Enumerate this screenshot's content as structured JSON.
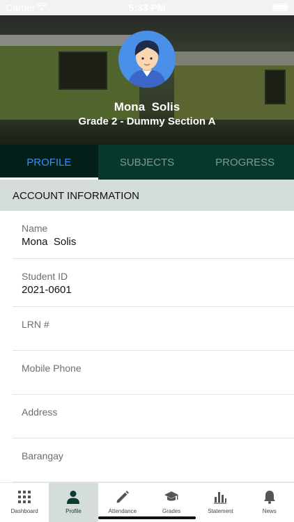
{
  "status_bar": {
    "carrier": "Carrier",
    "time": "5:33 PM"
  },
  "profile": {
    "name": "Mona  Solis",
    "section": "Grade 2 - Dummy Section A"
  },
  "tabs": [
    {
      "label": "PROFILE",
      "active": true
    },
    {
      "label": "SUBJECTS",
      "active": false
    },
    {
      "label": "PROGRESS",
      "active": false
    }
  ],
  "account_section": {
    "title": "ACCOUNT INFORMATION",
    "fields": [
      {
        "label": "Name",
        "value": "Mona  Solis"
      },
      {
        "label": "Student ID",
        "value": "2021-0601"
      },
      {
        "label": "LRN #",
        "value": ""
      },
      {
        "label": "Mobile Phone",
        "value": ""
      },
      {
        "label": "Address",
        "value": ""
      },
      {
        "label": "Barangay",
        "value": ""
      }
    ]
  },
  "bottom_nav": [
    {
      "label": "Dashboard",
      "icon": "grid-icon",
      "active": false
    },
    {
      "label": "Profile",
      "icon": "person-icon",
      "active": true
    },
    {
      "label": "Attendance",
      "icon": "pencil-icon",
      "active": false
    },
    {
      "label": "Grades",
      "icon": "graduation-cap-icon",
      "active": false
    },
    {
      "label": "Statement",
      "icon": "bar-chart-icon",
      "active": false
    },
    {
      "label": "News",
      "icon": "bell-icon",
      "active": false
    }
  ],
  "colors": {
    "tab_bar": "#06382c",
    "active_tab_text": "#3a8ef0",
    "section_header": "#d5dddb",
    "avatar_bg": "#4a8fe8"
  }
}
